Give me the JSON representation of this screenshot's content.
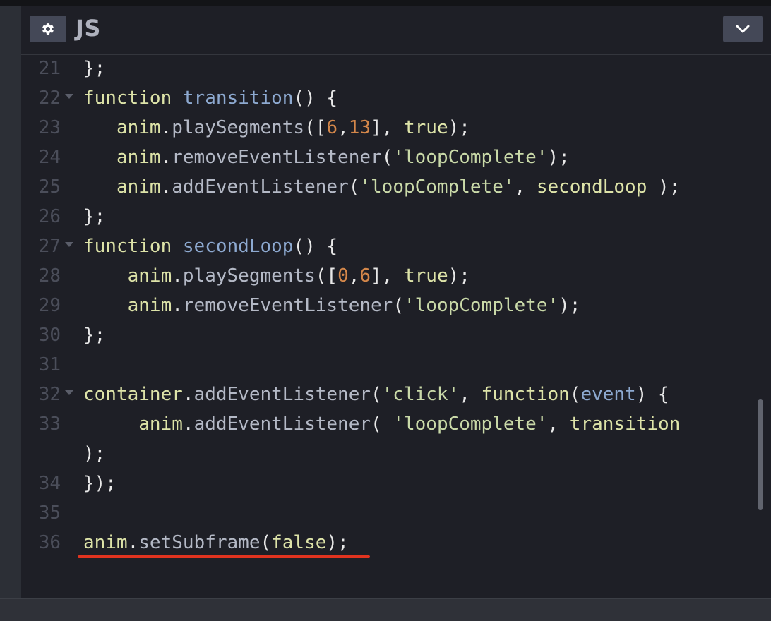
{
  "header": {
    "title": "JS",
    "settings_icon": "gear-icon",
    "collapse_icon": "chevron-down-icon"
  },
  "colors": {
    "keyword": "#dde3a8",
    "function_name": "#8da9d0",
    "number": "#d4874a",
    "string": "#c9d9a8",
    "annotation": "#e0331f"
  },
  "code": {
    "lines": [
      {
        "num": "21",
        "fold": false,
        "indent": "",
        "tokens": [
          [
            "pun",
            "};"
          ]
        ]
      },
      {
        "num": "22",
        "fold": true,
        "indent": "",
        "tokens": [
          [
            "kw",
            "function"
          ],
          [
            "pun",
            " "
          ],
          [
            "def",
            "transition"
          ],
          [
            "pun",
            "() {"
          ]
        ]
      },
      {
        "num": "23",
        "fold": false,
        "indent": "   ",
        "tokens": [
          [
            "var",
            "anim"
          ],
          [
            "pun",
            "."
          ],
          [
            "fn",
            "playSegments"
          ],
          [
            "pun",
            "(["
          ],
          [
            "num",
            "6"
          ],
          [
            "pun",
            ","
          ],
          [
            "num",
            "13"
          ],
          [
            "pun",
            "], "
          ],
          [
            "bool",
            "true"
          ],
          [
            "pun",
            ");"
          ]
        ]
      },
      {
        "num": "24",
        "fold": false,
        "indent": "   ",
        "tokens": [
          [
            "var",
            "anim"
          ],
          [
            "pun",
            "."
          ],
          [
            "fn",
            "removeEventListener"
          ],
          [
            "pun",
            "("
          ],
          [
            "str",
            "'loopComplete'"
          ],
          [
            "pun",
            ");"
          ]
        ]
      },
      {
        "num": "25",
        "fold": false,
        "indent": "   ",
        "tokens": [
          [
            "var",
            "anim"
          ],
          [
            "pun",
            "."
          ],
          [
            "fn",
            "addEventListener"
          ],
          [
            "pun",
            "("
          ],
          [
            "str",
            "'loopComplete'"
          ],
          [
            "pun",
            ", "
          ],
          [
            "var",
            "secondLoop"
          ],
          [
            "pun",
            " );"
          ]
        ]
      },
      {
        "num": "26",
        "fold": false,
        "indent": "",
        "tokens": [
          [
            "pun",
            "};"
          ]
        ]
      },
      {
        "num": "27",
        "fold": true,
        "indent": "",
        "tokens": [
          [
            "kw",
            "function"
          ],
          [
            "pun",
            " "
          ],
          [
            "def",
            "secondLoop"
          ],
          [
            "pun",
            "() {"
          ]
        ]
      },
      {
        "num": "28",
        "fold": false,
        "indent": "    ",
        "tokens": [
          [
            "var",
            "anim"
          ],
          [
            "pun",
            "."
          ],
          [
            "fn",
            "playSegments"
          ],
          [
            "pun",
            "(["
          ],
          [
            "num",
            "0"
          ],
          [
            "pun",
            ","
          ],
          [
            "num",
            "6"
          ],
          [
            "pun",
            "], "
          ],
          [
            "bool",
            "true"
          ],
          [
            "pun",
            ");"
          ]
        ]
      },
      {
        "num": "29",
        "fold": false,
        "indent": "    ",
        "tokens": [
          [
            "var",
            "anim"
          ],
          [
            "pun",
            "."
          ],
          [
            "fn",
            "removeEventListener"
          ],
          [
            "pun",
            "("
          ],
          [
            "str",
            "'loopComplete'"
          ],
          [
            "pun",
            ");"
          ]
        ]
      },
      {
        "num": "30",
        "fold": false,
        "indent": "",
        "tokens": [
          [
            "pun",
            "};"
          ]
        ]
      },
      {
        "num": "31",
        "fold": false,
        "indent": "",
        "tokens": []
      },
      {
        "num": "32",
        "fold": true,
        "indent": "",
        "tokens": [
          [
            "var",
            "container"
          ],
          [
            "pun",
            "."
          ],
          [
            "fn",
            "addEventListener"
          ],
          [
            "pun",
            "("
          ],
          [
            "str",
            "'click'"
          ],
          [
            "pun",
            ", "
          ],
          [
            "kw",
            "function"
          ],
          [
            "pun",
            "("
          ],
          [
            "param",
            "event"
          ],
          [
            "pun",
            ") {"
          ]
        ]
      },
      {
        "num": "33",
        "fold": false,
        "indent": "     ",
        "tokens": [
          [
            "var",
            "anim"
          ],
          [
            "pun",
            "."
          ],
          [
            "fn",
            "addEventListener"
          ],
          [
            "pun",
            "( "
          ],
          [
            "str",
            "'loopComplete'"
          ],
          [
            "pun",
            ", "
          ],
          [
            "var",
            "transition"
          ]
        ]
      },
      {
        "num": "",
        "fold": false,
        "indent": "",
        "tokens": [
          [
            "pun",
            ");"
          ]
        ]
      },
      {
        "num": "34",
        "fold": false,
        "indent": "",
        "tokens": [
          [
            "pun",
            "});"
          ]
        ]
      },
      {
        "num": "35",
        "fold": false,
        "indent": "",
        "tokens": []
      },
      {
        "num": "36",
        "fold": false,
        "indent": "",
        "tokens": [
          [
            "var",
            "anim"
          ],
          [
            "pun",
            "."
          ],
          [
            "fn",
            "setSubframe"
          ],
          [
            "pun",
            "("
          ],
          [
            "bool",
            "false"
          ],
          [
            "pun",
            ");"
          ]
        ]
      }
    ]
  }
}
